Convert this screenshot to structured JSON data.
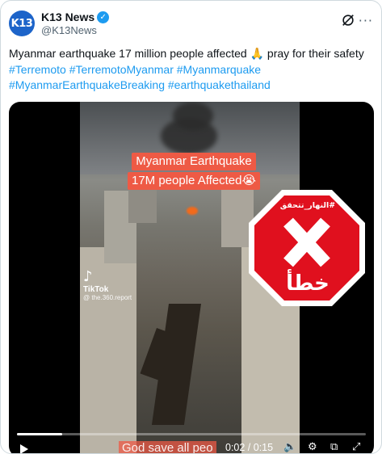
{
  "account": {
    "avatar_text": "K13",
    "name": "K13 News",
    "verified_icon": "verified-badge-icon",
    "handle": "@K13News"
  },
  "tweet": {
    "text": "Myanmar earthquake 17 million people affected 🙏 pray for their safety",
    "hashtags": [
      "#Terremoto",
      "#TerremotoMyanmar",
      "#Myanmarquake",
      "#MyanmarEarthquakeBreaking",
      "#earthquakethailand"
    ]
  },
  "video": {
    "caption_line1": "Myanmar Earthquake",
    "caption_line2": "17M people Affected😭",
    "tiktok_brand": "TikTok",
    "tiktok_user": "@ the.360.report",
    "bottom_caption": "God save all peo",
    "stamp_tag": "#النهار_تتحقق",
    "stamp_word": "خطأ",
    "progress": 0.13,
    "time": "0:02 / 0:15"
  },
  "colors": {
    "link": "#1d9bf0",
    "stamp_red": "#e0101e",
    "caption_bg": "#ee5a45",
    "avatar_bg": "#1d64c9"
  }
}
